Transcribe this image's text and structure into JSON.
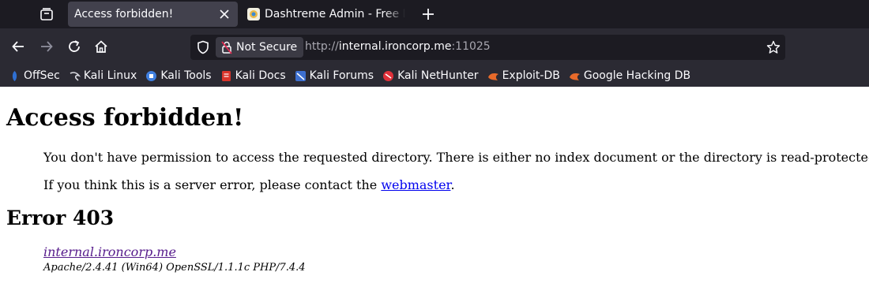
{
  "tabs": [
    {
      "title": "Access forbidden!",
      "active": true
    },
    {
      "title": "Dashtreme Admin - Free D",
      "active": false
    }
  ],
  "navbar": {
    "security_label": "Not Secure",
    "url_prefix": "http://",
    "url_host": "internal.ironcorp.me",
    "url_suffix": ":11025"
  },
  "bookmarks": [
    {
      "label": "OffSec",
      "icon": "offsec-icon",
      "color": "#2f6fd1"
    },
    {
      "label": "Kali Linux",
      "icon": "kali-dragon-icon",
      "color": "#d9d9e0"
    },
    {
      "label": "Kali Tools",
      "icon": "kali-tools-icon",
      "color": "#3f7fe0"
    },
    {
      "label": "Kali Docs",
      "icon": "kali-docs-icon",
      "color": "#d9342b"
    },
    {
      "label": "Kali Forums",
      "icon": "kali-forums-icon",
      "color": "#3d6fcf"
    },
    {
      "label": "Kali NetHunter",
      "icon": "nethunter-icon",
      "color": "#e0303a"
    },
    {
      "label": "Exploit-DB",
      "icon": "exploit-db-icon",
      "color": "#e86a2a"
    },
    {
      "label": "Google Hacking DB",
      "icon": "ghdb-icon",
      "color": "#e86a2a"
    }
  ],
  "page": {
    "heading": "Access forbidden!",
    "message1": "You don't have permission to access the requested directory. There is either no index document or the directory is read-protected.",
    "message2_prefix": "If you think this is a server error, please contact the ",
    "message2_link": "webmaster",
    "message2_suffix": ".",
    "error_heading": "Error 403",
    "address_link": "internal.ironcorp.me",
    "server_signature": "Apache/2.4.41 (Win64) OpenSSL/1.1.1c PHP/7.4.4"
  },
  "colors": {
    "link": "#0000ee",
    "visited_link": "#551a8b",
    "chrome_bg": "#2b2a33",
    "tabstrip_bg": "#1c1b22"
  }
}
